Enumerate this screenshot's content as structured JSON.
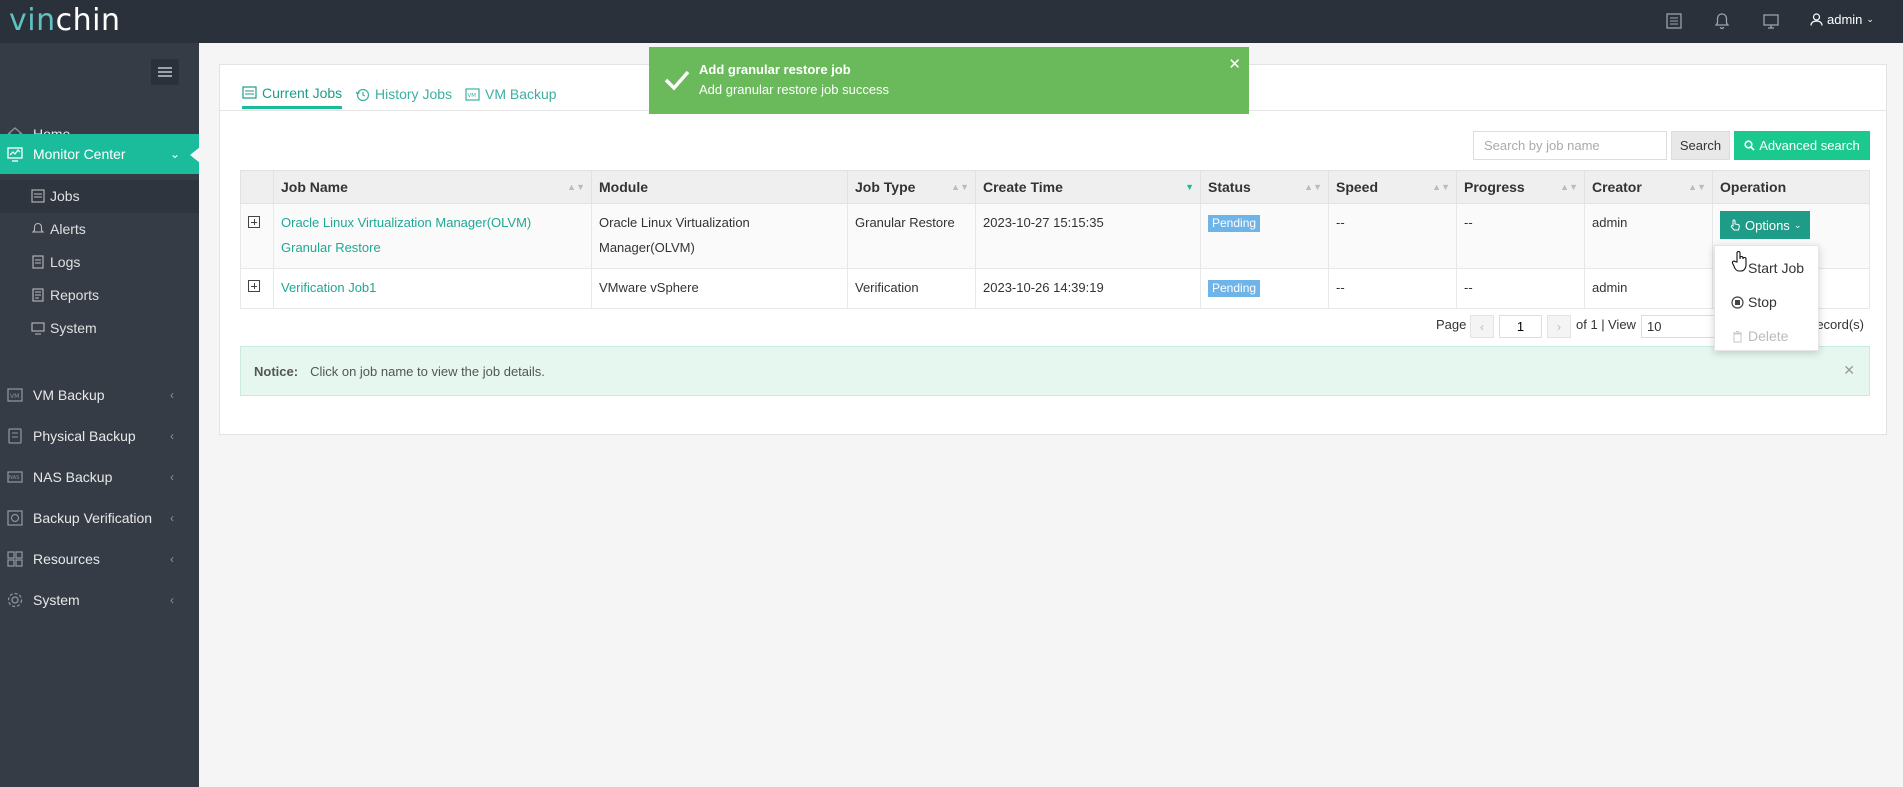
{
  "header": {
    "logo_part1": "vin",
    "logo_part2": "chin",
    "user": "admin"
  },
  "sidebar": {
    "items": [
      {
        "label": "Home"
      },
      {
        "label": "Monitor Center"
      },
      {
        "label": "VM Backup"
      },
      {
        "label": "Physical Backup"
      },
      {
        "label": "NAS Backup"
      },
      {
        "label": "Backup Verification"
      },
      {
        "label": "Resources"
      },
      {
        "label": "System"
      }
    ],
    "sub_items": [
      {
        "label": "Jobs"
      },
      {
        "label": "Alerts"
      },
      {
        "label": "Logs"
      },
      {
        "label": "Reports"
      },
      {
        "label": "System"
      }
    ]
  },
  "tabs": [
    {
      "label": "Current Jobs"
    },
    {
      "label": "History Jobs"
    },
    {
      "label": "VM Backup"
    }
  ],
  "search": {
    "placeholder": "Search by job name",
    "button": "Search",
    "advanced": "Advanced search"
  },
  "table": {
    "headers": [
      "Job Name",
      "Module",
      "Job Type",
      "Create Time",
      "Status",
      "Speed",
      "Progress",
      "Creator",
      "Operation"
    ],
    "rows": [
      {
        "job_name": "Oracle Linux Virtualization Manager(OLVM) Granular Restore",
        "module": "Oracle Linux Virtualization Manager(OLVM)",
        "job_type": "Granular Restore",
        "create_time": "2023-10-27 15:15:35",
        "status": "Pending",
        "speed": "--",
        "progress": "--",
        "creator": "admin",
        "operation": "Options"
      },
      {
        "job_name": "Verification Job1",
        "module": "VMware vSphere",
        "job_type": "Verification",
        "create_time": "2023-10-26 14:39:19",
        "status": "Pending",
        "speed": "--",
        "progress": "--",
        "creator": "admin",
        "operation": ""
      }
    ]
  },
  "pager": {
    "page_label": "Page",
    "page_value": "1",
    "of_label": "of 1 |",
    "view_label": "View",
    "view_value": "10",
    "records_label": "record(s)"
  },
  "notice": {
    "label": "Notice:",
    "text": "Click on job name to view the job details."
  },
  "toast": {
    "title": "Add granular restore job",
    "message": "Add granular restore job success"
  },
  "dropdown": {
    "items": [
      {
        "label": "Start Job"
      },
      {
        "label": "Stop"
      },
      {
        "label": "Delete"
      }
    ]
  },
  "colors": {
    "accent": "#1abc9c",
    "sidebar": "#363c46",
    "topbar": "#2b313a",
    "toast": "#6aba5c",
    "badge": "#6fb4e7"
  }
}
